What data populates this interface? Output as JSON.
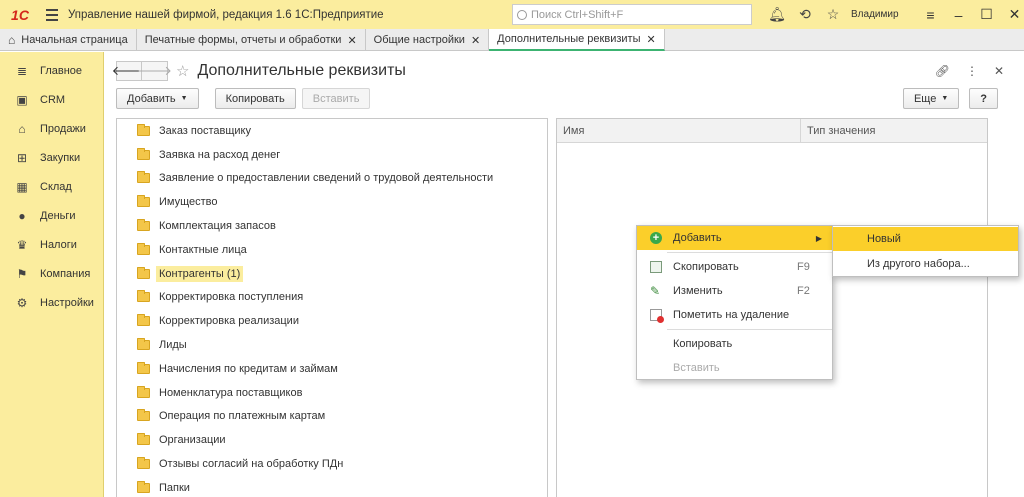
{
  "titlebar": {
    "logo": "1С",
    "app_title": "Управление нашей фирмой, редакция 1.6 1С:Предприятие",
    "search_placeholder": "Поиск Ctrl+Shift+F",
    "user": "Владимир"
  },
  "tabs": [
    {
      "label": "Начальная страница",
      "closable": false
    },
    {
      "label": "Печатные формы, отчеты и обработки",
      "closable": true
    },
    {
      "label": "Общие настройки",
      "closable": true
    },
    {
      "label": "Дополнительные реквизиты",
      "closable": true,
      "active": true
    }
  ],
  "sidebar": {
    "items": [
      {
        "label": "Главное",
        "icon": "menu-lines-icon"
      },
      {
        "label": "CRM",
        "icon": "contact-card-icon"
      },
      {
        "label": "Продажи",
        "icon": "shop-icon"
      },
      {
        "label": "Закупки",
        "icon": "cart-icon"
      },
      {
        "label": "Склад",
        "icon": "warehouse-grid-icon"
      },
      {
        "label": "Деньги",
        "icon": "coin-icon"
      },
      {
        "label": "Налоги",
        "icon": "eagle-icon"
      },
      {
        "label": "Компания",
        "icon": "flag-icon"
      },
      {
        "label": "Настройки",
        "icon": "gear-icon"
      }
    ]
  },
  "page": {
    "title": "Дополнительные реквизиты",
    "add_label": "Добавить",
    "copy_label": "Копировать",
    "paste_label": "Вставить",
    "more_label": "Еще",
    "help_label": "?"
  },
  "tree": {
    "items": [
      "Заказ поставщику",
      "Заявка на расход денег",
      "Заявление о предоставлении сведений о трудовой деятельности",
      "Имущество",
      "Комплектация запасов",
      "Контактные лица",
      "Контрагенты (1)",
      "Корректировка поступления",
      "Корректировка реализации",
      "Лиды",
      "Начисления по кредитам и займам",
      "Номенклатура поставщиков",
      "Операция по платежным картам",
      "Организации",
      "Отзывы согласий на обработку ПДн",
      "Папки"
    ],
    "selected_index": 6
  },
  "grid": {
    "columns": [
      "Имя",
      "Тип значения"
    ]
  },
  "context_menu": {
    "add": "Добавить",
    "copy": "Скопировать",
    "copy_key": "F9",
    "edit": "Изменить",
    "edit_key": "F2",
    "mark_delete": "Пометить на удаление",
    "copy2": "Копировать",
    "paste": "Вставить"
  },
  "submenu": {
    "new": "Новый",
    "from_set": "Из другого набора..."
  },
  "colors": {
    "accent_yellow": "#fbed9e",
    "highlight": "#fbcf2a",
    "active_tab_line": "#3cb371"
  }
}
